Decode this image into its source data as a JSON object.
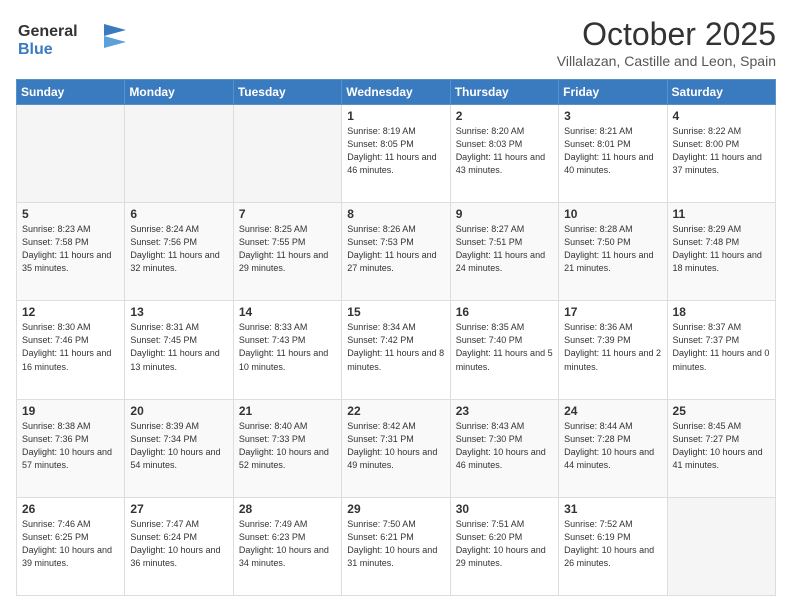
{
  "header": {
    "logo_line1": "General",
    "logo_line2": "Blue",
    "month": "October 2025",
    "location": "Villalazan, Castille and Leon, Spain"
  },
  "weekdays": [
    "Sunday",
    "Monday",
    "Tuesday",
    "Wednesday",
    "Thursday",
    "Friday",
    "Saturday"
  ],
  "weeks": [
    [
      {
        "day": "",
        "content": ""
      },
      {
        "day": "",
        "content": ""
      },
      {
        "day": "",
        "content": ""
      },
      {
        "day": "1",
        "content": "Sunrise: 8:19 AM\nSunset: 8:05 PM\nDaylight: 11 hours\nand 46 minutes."
      },
      {
        "day": "2",
        "content": "Sunrise: 8:20 AM\nSunset: 8:03 PM\nDaylight: 11 hours\nand 43 minutes."
      },
      {
        "day": "3",
        "content": "Sunrise: 8:21 AM\nSunset: 8:01 PM\nDaylight: 11 hours\nand 40 minutes."
      },
      {
        "day": "4",
        "content": "Sunrise: 8:22 AM\nSunset: 8:00 PM\nDaylight: 11 hours\nand 37 minutes."
      }
    ],
    [
      {
        "day": "5",
        "content": "Sunrise: 8:23 AM\nSunset: 7:58 PM\nDaylight: 11 hours\nand 35 minutes."
      },
      {
        "day": "6",
        "content": "Sunrise: 8:24 AM\nSunset: 7:56 PM\nDaylight: 11 hours\nand 32 minutes."
      },
      {
        "day": "7",
        "content": "Sunrise: 8:25 AM\nSunset: 7:55 PM\nDaylight: 11 hours\nand 29 minutes."
      },
      {
        "day": "8",
        "content": "Sunrise: 8:26 AM\nSunset: 7:53 PM\nDaylight: 11 hours\nand 27 minutes."
      },
      {
        "day": "9",
        "content": "Sunrise: 8:27 AM\nSunset: 7:51 PM\nDaylight: 11 hours\nand 24 minutes."
      },
      {
        "day": "10",
        "content": "Sunrise: 8:28 AM\nSunset: 7:50 PM\nDaylight: 11 hours\nand 21 minutes."
      },
      {
        "day": "11",
        "content": "Sunrise: 8:29 AM\nSunset: 7:48 PM\nDaylight: 11 hours\nand 18 minutes."
      }
    ],
    [
      {
        "day": "12",
        "content": "Sunrise: 8:30 AM\nSunset: 7:46 PM\nDaylight: 11 hours\nand 16 minutes."
      },
      {
        "day": "13",
        "content": "Sunrise: 8:31 AM\nSunset: 7:45 PM\nDaylight: 11 hours\nand 13 minutes."
      },
      {
        "day": "14",
        "content": "Sunrise: 8:33 AM\nSunset: 7:43 PM\nDaylight: 11 hours\nand 10 minutes."
      },
      {
        "day": "15",
        "content": "Sunrise: 8:34 AM\nSunset: 7:42 PM\nDaylight: 11 hours\nand 8 minutes."
      },
      {
        "day": "16",
        "content": "Sunrise: 8:35 AM\nSunset: 7:40 PM\nDaylight: 11 hours\nand 5 minutes."
      },
      {
        "day": "17",
        "content": "Sunrise: 8:36 AM\nSunset: 7:39 PM\nDaylight: 11 hours\nand 2 minutes."
      },
      {
        "day": "18",
        "content": "Sunrise: 8:37 AM\nSunset: 7:37 PM\nDaylight: 11 hours\nand 0 minutes."
      }
    ],
    [
      {
        "day": "19",
        "content": "Sunrise: 8:38 AM\nSunset: 7:36 PM\nDaylight: 10 hours\nand 57 minutes."
      },
      {
        "day": "20",
        "content": "Sunrise: 8:39 AM\nSunset: 7:34 PM\nDaylight: 10 hours\nand 54 minutes."
      },
      {
        "day": "21",
        "content": "Sunrise: 8:40 AM\nSunset: 7:33 PM\nDaylight: 10 hours\nand 52 minutes."
      },
      {
        "day": "22",
        "content": "Sunrise: 8:42 AM\nSunset: 7:31 PM\nDaylight: 10 hours\nand 49 minutes."
      },
      {
        "day": "23",
        "content": "Sunrise: 8:43 AM\nSunset: 7:30 PM\nDaylight: 10 hours\nand 46 minutes."
      },
      {
        "day": "24",
        "content": "Sunrise: 8:44 AM\nSunset: 7:28 PM\nDaylight: 10 hours\nand 44 minutes."
      },
      {
        "day": "25",
        "content": "Sunrise: 8:45 AM\nSunset: 7:27 PM\nDaylight: 10 hours\nand 41 minutes."
      }
    ],
    [
      {
        "day": "26",
        "content": "Sunrise: 7:46 AM\nSunset: 6:25 PM\nDaylight: 10 hours\nand 39 minutes."
      },
      {
        "day": "27",
        "content": "Sunrise: 7:47 AM\nSunset: 6:24 PM\nDaylight: 10 hours\nand 36 minutes."
      },
      {
        "day": "28",
        "content": "Sunrise: 7:49 AM\nSunset: 6:23 PM\nDaylight: 10 hours\nand 34 minutes."
      },
      {
        "day": "29",
        "content": "Sunrise: 7:50 AM\nSunset: 6:21 PM\nDaylight: 10 hours\nand 31 minutes."
      },
      {
        "day": "30",
        "content": "Sunrise: 7:51 AM\nSunset: 6:20 PM\nDaylight: 10 hours\nand 29 minutes."
      },
      {
        "day": "31",
        "content": "Sunrise: 7:52 AM\nSunset: 6:19 PM\nDaylight: 10 hours\nand 26 minutes."
      },
      {
        "day": "",
        "content": ""
      }
    ]
  ]
}
